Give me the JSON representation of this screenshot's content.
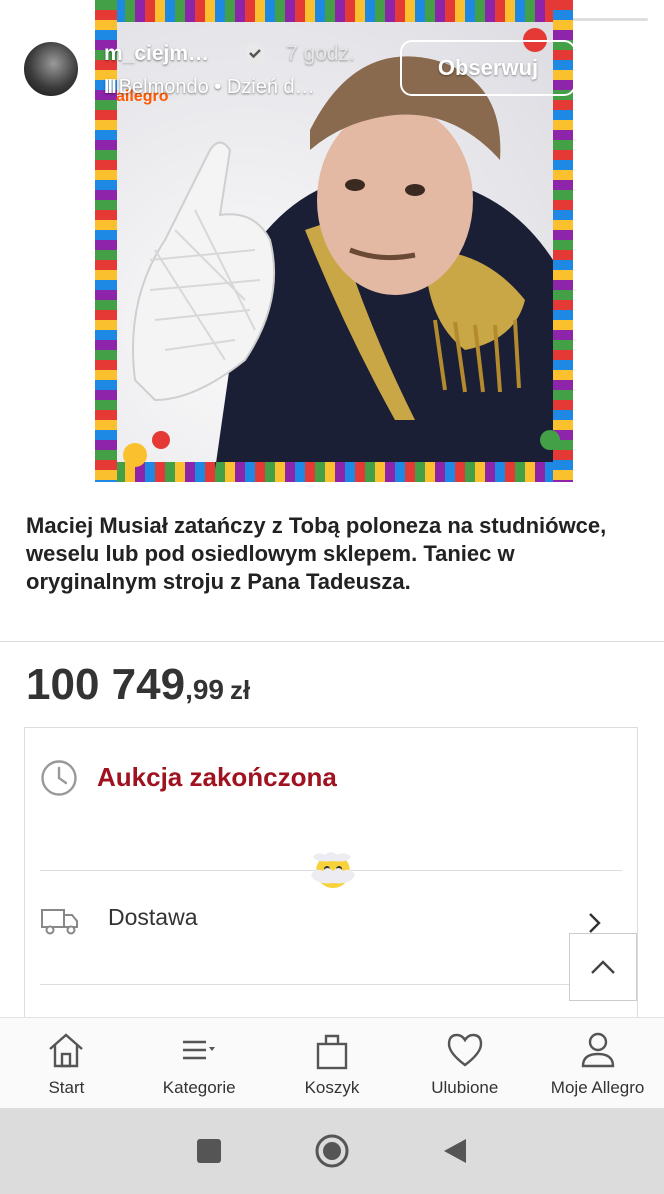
{
  "story": {
    "progress_fraction": 0.6,
    "username": "m_ciejm…",
    "time": "7 godz.",
    "music": "Belmondo • Dzień d…",
    "follow_label": "Obserwuj",
    "image_logo_text": "allegro"
  },
  "listing": {
    "headline": "Maciej Musiał zatańczy z Tobą poloneza na studniówce, weselu lub pod osiedlowym sklepem. Taniec w oryginalnym stroju z Pana Tadeusza.",
    "price_integer": "100 749",
    "price_decimal": ",99",
    "price_currency": "zł",
    "auction_status": "Aukcja zakończona",
    "delivery_label": "Dostawa"
  },
  "nav": {
    "items": [
      {
        "label": "Start",
        "icon": "home-icon"
      },
      {
        "label": "Kategorie",
        "icon": "menu-icon"
      },
      {
        "label": "Koszyk",
        "icon": "cart-icon"
      },
      {
        "label": "Ulubione",
        "icon": "heart-icon"
      },
      {
        "label": "Moje Allegro",
        "icon": "user-icon"
      }
    ]
  },
  "colors": {
    "accent_red": "#a01220",
    "allegro_orange": "#ff5a00"
  }
}
